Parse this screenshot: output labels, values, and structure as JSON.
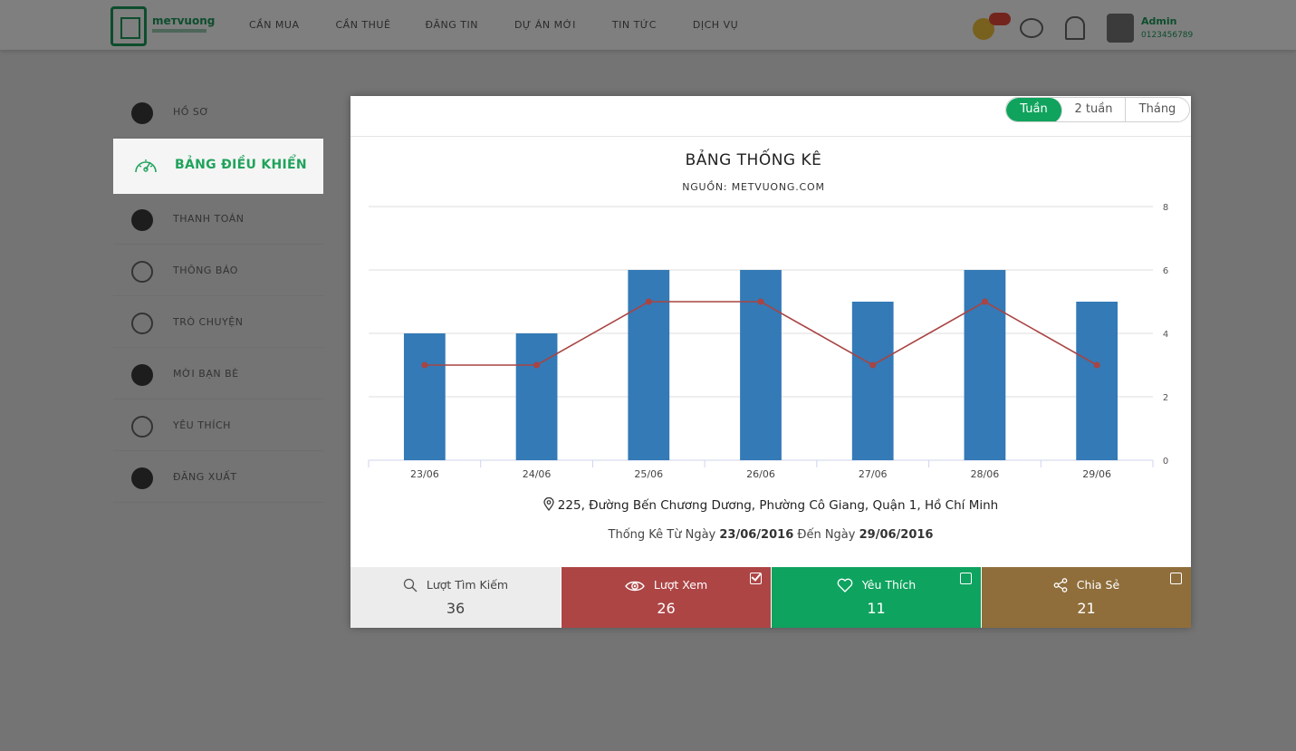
{
  "header": {
    "logo_text": "mетvuong",
    "nav": [
      "CẦN MUA",
      "CẦN THUÊ",
      "ĐĂNG TIN",
      "DỰ ÁN MỚI",
      "TIN TỨC",
      "DỊCH VỤ"
    ],
    "coin_badge": "",
    "user_name": "Admin",
    "user_sub": "0123456789"
  },
  "sidebar": {
    "items": [
      {
        "label": "HỒ SƠ",
        "icon": "plus-circle-icon"
      },
      {
        "label": "BẢNG ĐIỀU KHIỂN",
        "icon": "gauge-icon",
        "active": true
      },
      {
        "label": "THANH TOÁN",
        "icon": "dollar-icon"
      },
      {
        "label": "THÔNG BÁO",
        "icon": "bell-icon"
      },
      {
        "label": "TRÒ CHUYỆN",
        "icon": "chat-icon"
      },
      {
        "label": "MỜI BẠN BÈ",
        "icon": "invite-icon"
      },
      {
        "label": "YÊU THÍCH",
        "icon": "heart-icon"
      },
      {
        "label": "ĐĂNG XUẤT",
        "icon": "logout-icon"
      }
    ]
  },
  "modal": {
    "range_buttons": [
      "Tuần",
      "2 tuần",
      "Tháng"
    ],
    "active_range": "Tuần",
    "address": "225, Đường Bến Chương Dương, Phường Cô Giang, Quận 1, Hồ Chí Minh",
    "period_prefix": "Thống Kê Từ Ngày",
    "period_from": "23/06/2016",
    "period_mid": "Đến Ngày",
    "period_to": "29/06/2016",
    "stats": [
      {
        "label": "Lượt Tìm Kiếm",
        "value": "36",
        "icon": "search-icon",
        "checked": null,
        "color": "#ececec"
      },
      {
        "label": "Lượt Xem",
        "value": "26",
        "icon": "eye-icon",
        "checked": true,
        "color": "#ad4545"
      },
      {
        "label": "Yêu Thích",
        "value": "11",
        "icon": "heart-icon",
        "checked": false,
        "color": "#0ea35f"
      },
      {
        "label": "Chia Sẻ",
        "value": "21",
        "icon": "share-icon",
        "checked": false,
        "color": "#8f6e3b"
      }
    ]
  },
  "chart_data": {
    "type": "bar",
    "title": "BẢNG THỐNG KÊ",
    "subtitle": "NGUỒN: METVUONG.COM",
    "categories": [
      "23/06",
      "24/06",
      "25/06",
      "26/06",
      "27/06",
      "28/06",
      "29/06"
    ],
    "series": [
      {
        "type": "bar",
        "values": [
          4,
          4,
          6,
          6,
          5,
          6,
          5
        ],
        "color": "#337ab7"
      },
      {
        "type": "line",
        "values": [
          3,
          3,
          5,
          5,
          3,
          5,
          3
        ],
        "color": "#a94442"
      }
    ],
    "y_ticks": [
      0,
      2,
      4,
      6,
      8
    ],
    "ylim": [
      0,
      8
    ],
    "y_axis_side": "right",
    "grid": true
  }
}
